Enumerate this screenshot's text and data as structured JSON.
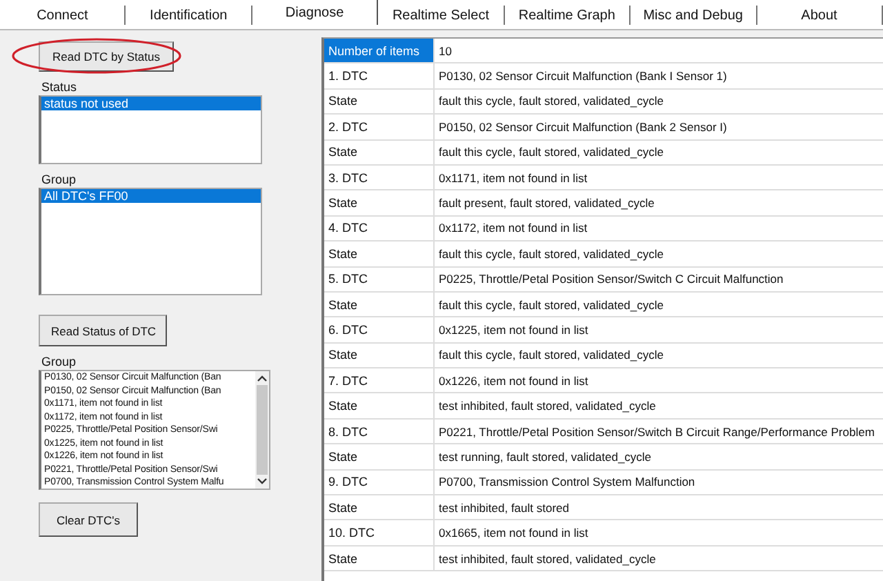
{
  "tabs": [
    {
      "label": "Connect",
      "selected": false
    },
    {
      "label": "Identification",
      "selected": false
    },
    {
      "label": "Diagnose",
      "selected": true
    },
    {
      "label": "Realtime Select",
      "selected": false
    },
    {
      "label": "Realtime Graph",
      "selected": false
    },
    {
      "label": "Misc and Debug",
      "selected": false
    },
    {
      "label": "About",
      "selected": false
    }
  ],
  "read_by_status_button": {
    "label": "Read DTC by Status",
    "highlighted": true
  },
  "status_list": {
    "label": "Status",
    "items": [
      {
        "text": "status not used",
        "selected": true
      }
    ]
  },
  "group_list": {
    "label": "Group",
    "items": [
      {
        "text": "All DTC's FF00",
        "selected": true
      }
    ]
  },
  "read_status_button": {
    "label": "Read Status of DTC"
  },
  "result_list": {
    "label": "Group",
    "items": [
      {
        "text": "P0130, 02 Sensor Circuit Malfunction (Ban",
        "selected": false
      },
      {
        "text": "P0150, 02 Sensor Circuit Malfunction (Ban",
        "selected": false
      },
      {
        "text": "0x1171, item not found in list",
        "selected": false
      },
      {
        "text": "0x1172, item not found in list",
        "selected": false
      },
      {
        "text": "P0225, Throttle/Petal Position Sensor/Swi",
        "selected": false
      },
      {
        "text": "0x1225, item not found in list",
        "selected": false
      },
      {
        "text": "0x1226, item not found in list",
        "selected": false
      },
      {
        "text": "P0221, Throttle/Petal Position Sensor/Swi",
        "selected": false
      },
      {
        "text": "P0700, Transmission Control System Malfu",
        "selected": false
      }
    ]
  },
  "clear_button": {
    "label": "Clear DTC's"
  },
  "table": {
    "rows": [
      {
        "name": "Number of items",
        "value": "10",
        "selected": true
      },
      {
        "name": "1. DTC",
        "value": "P0130, 02 Sensor Circuit Malfunction (Bank I Sensor 1)",
        "selected": false
      },
      {
        "name": "State",
        "value": "fault this cycle, fault stored, validated_cycle",
        "selected": false
      },
      {
        "name": "2. DTC",
        "value": "P0150, 02 Sensor Circuit Malfunction (Bank 2 Sensor I)",
        "selected": false
      },
      {
        "name": "State",
        "value": "fault this cycle, fault stored, validated_cycle",
        "selected": false
      },
      {
        "name": "3. DTC",
        "value": "0x1171, item not found in list",
        "selected": false
      },
      {
        "name": "State",
        "value": "fault present, fault stored, validated_cycle",
        "selected": false
      },
      {
        "name": "4. DTC",
        "value": "0x1172, item not found in list",
        "selected": false
      },
      {
        "name": "State",
        "value": "fault this cycle, fault stored, validated_cycle",
        "selected": false
      },
      {
        "name": "5. DTC",
        "value": "P0225, Throttle/Petal Position Sensor/Switch C Circuit Malfunction",
        "selected": false
      },
      {
        "name": "State",
        "value": "fault this cycle, fault stored, validated_cycle",
        "selected": false
      },
      {
        "name": "6. DTC",
        "value": "0x1225, item not found in list",
        "selected": false
      },
      {
        "name": "State",
        "value": "fault this cycle, fault stored, validated_cycle",
        "selected": false
      },
      {
        "name": "7. DTC",
        "value": "0x1226, item not found in list",
        "selected": false
      },
      {
        "name": "State",
        "value": "test inhibited, fault stored, validated_cycle",
        "selected": false
      },
      {
        "name": "8. DTC",
        "value": "P0221, Throttle/Petal Position Sensor/Switch B Circuit Range/Performance Problem",
        "selected": false
      },
      {
        "name": "State",
        "value": "test running, fault stored, validated_cycle",
        "selected": false
      },
      {
        "name": "9. DTC",
        "value": "P0700, Transmission Control System Malfunction",
        "selected": false
      },
      {
        "name": "State",
        "value": "test inhibited, fault stored",
        "selected": false
      },
      {
        "name": "10. DTC",
        "value": "0x1665, item not found in list",
        "selected": false
      },
      {
        "name": "State",
        "value": "test inhibited, fault stored, validated_cycle",
        "selected": false
      }
    ]
  }
}
